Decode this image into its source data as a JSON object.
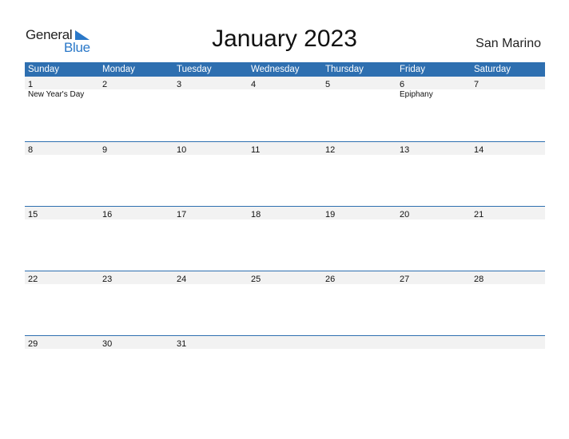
{
  "logo": {
    "general": "General",
    "blue": "Blue",
    "icon": "triangle-flag-icon"
  },
  "title": "January 2023",
  "country": "San Marino",
  "colors": {
    "header": "#2e6fb0",
    "accent": "#2a78c8",
    "date_band": "#f2f2f2"
  },
  "weekdays": [
    "Sunday",
    "Monday",
    "Tuesday",
    "Wednesday",
    "Thursday",
    "Friday",
    "Saturday"
  ],
  "weeks": [
    {
      "days": [
        {
          "num": "1",
          "holiday": "New Year's Day"
        },
        {
          "num": "2",
          "holiday": ""
        },
        {
          "num": "3",
          "holiday": ""
        },
        {
          "num": "4",
          "holiday": ""
        },
        {
          "num": "5",
          "holiday": ""
        },
        {
          "num": "6",
          "holiday": "Epiphany"
        },
        {
          "num": "7",
          "holiday": ""
        }
      ]
    },
    {
      "days": [
        {
          "num": "8"
        },
        {
          "num": "9"
        },
        {
          "num": "10"
        },
        {
          "num": "11"
        },
        {
          "num": "12"
        },
        {
          "num": "13"
        },
        {
          "num": "14"
        }
      ]
    },
    {
      "days": [
        {
          "num": "15"
        },
        {
          "num": "16"
        },
        {
          "num": "17"
        },
        {
          "num": "18"
        },
        {
          "num": "19"
        },
        {
          "num": "20"
        },
        {
          "num": "21"
        }
      ]
    },
    {
      "days": [
        {
          "num": "22"
        },
        {
          "num": "23"
        },
        {
          "num": "24"
        },
        {
          "num": "25"
        },
        {
          "num": "26"
        },
        {
          "num": "27"
        },
        {
          "num": "28"
        }
      ]
    },
    {
      "days": [
        {
          "num": "29"
        },
        {
          "num": "30"
        },
        {
          "num": "31"
        },
        {
          "num": ""
        },
        {
          "num": ""
        },
        {
          "num": ""
        },
        {
          "num": ""
        }
      ]
    }
  ]
}
